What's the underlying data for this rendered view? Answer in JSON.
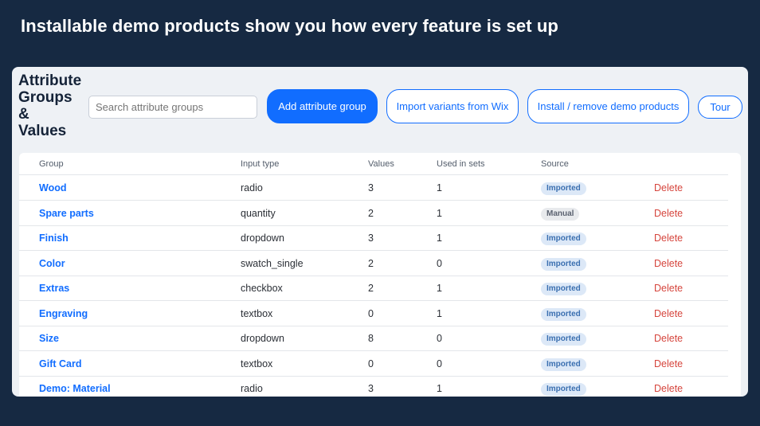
{
  "headline": "Installable demo products show you how every feature is set up",
  "page_title_lines": [
    "Attribute",
    "Groups",
    "&",
    "Values"
  ],
  "search": {
    "placeholder": "Search attribute groups"
  },
  "toolbar": {
    "add_label": "Add attribute group",
    "import_label": "Import variants from Wix",
    "install_label": "Install / remove demo products",
    "tour_label": "Tour"
  },
  "colors": {
    "background": "#162942",
    "accent": "#116dff",
    "delete": "#d6453d",
    "imported_badge": "#dce8f7",
    "manual_badge": "#e8eaed"
  },
  "table": {
    "headers": [
      "Group",
      "Input type",
      "Values",
      "Used in sets",
      "Source"
    ],
    "delete_label": "Delete",
    "rows": [
      {
        "group": "Wood",
        "input_type": "radio",
        "values": "3",
        "used_in_sets": "1",
        "source": "Imported"
      },
      {
        "group": "Spare parts",
        "input_type": "quantity",
        "values": "2",
        "used_in_sets": "1",
        "source": "Manual"
      },
      {
        "group": "Finish",
        "input_type": "dropdown",
        "values": "3",
        "used_in_sets": "1",
        "source": "Imported"
      },
      {
        "group": "Color",
        "input_type": "swatch_single",
        "values": "2",
        "used_in_sets": "0",
        "source": "Imported"
      },
      {
        "group": "Extras",
        "input_type": "checkbox",
        "values": "2",
        "used_in_sets": "1",
        "source": "Imported"
      },
      {
        "group": "Engraving",
        "input_type": "textbox",
        "values": "0",
        "used_in_sets": "1",
        "source": "Imported"
      },
      {
        "group": "Size",
        "input_type": "dropdown",
        "values": "8",
        "used_in_sets": "0",
        "source": "Imported"
      },
      {
        "group": "Gift Card",
        "input_type": "textbox",
        "values": "0",
        "used_in_sets": "0",
        "source": "Imported"
      },
      {
        "group": "Demo: Material",
        "input_type": "radio",
        "values": "3",
        "used_in_sets": "1",
        "source": "Imported"
      }
    ]
  }
}
